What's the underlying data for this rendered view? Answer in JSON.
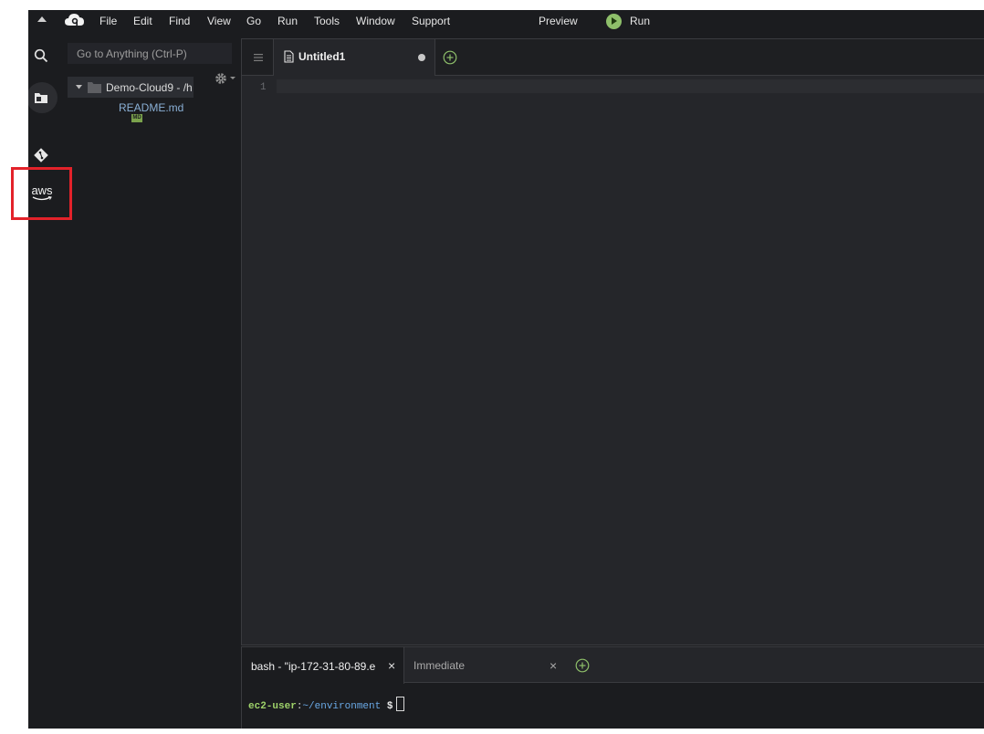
{
  "menubar": {
    "items": [
      "File",
      "Edit",
      "Find",
      "View",
      "Go",
      "Run",
      "Tools",
      "Window",
      "Support"
    ],
    "preview_label": "Preview",
    "run_label": "Run"
  },
  "sidebar": {
    "icons": [
      "search-icon",
      "files-icon",
      "git-icon",
      "aws-icon"
    ],
    "aws_label": "aws"
  },
  "file_tree": {
    "search_placeholder": "Go to Anything (Ctrl-P)",
    "root_label": "Demo-Cloud9 - /h",
    "files": [
      {
        "name": "README.md",
        "badge": "MD"
      }
    ]
  },
  "editor": {
    "tabs": [
      {
        "label": "Untitled1",
        "modified": true
      }
    ],
    "line_numbers": [
      "1"
    ]
  },
  "terminal": {
    "tabs": [
      "bash - \"ip-172-31-80-89.e",
      "Immediate"
    ],
    "close_glyph": "×",
    "prompt_user": "ec2-user",
    "prompt_colon": ":",
    "prompt_path": "~/environment",
    "prompt_symbol": "$"
  },
  "colors": {
    "background": "#1b1c1f",
    "editor_bg": "#25262a",
    "accent_green": "#8ebf6a",
    "highlight": "#e3222a",
    "link_blue": "#8ab0d6"
  }
}
